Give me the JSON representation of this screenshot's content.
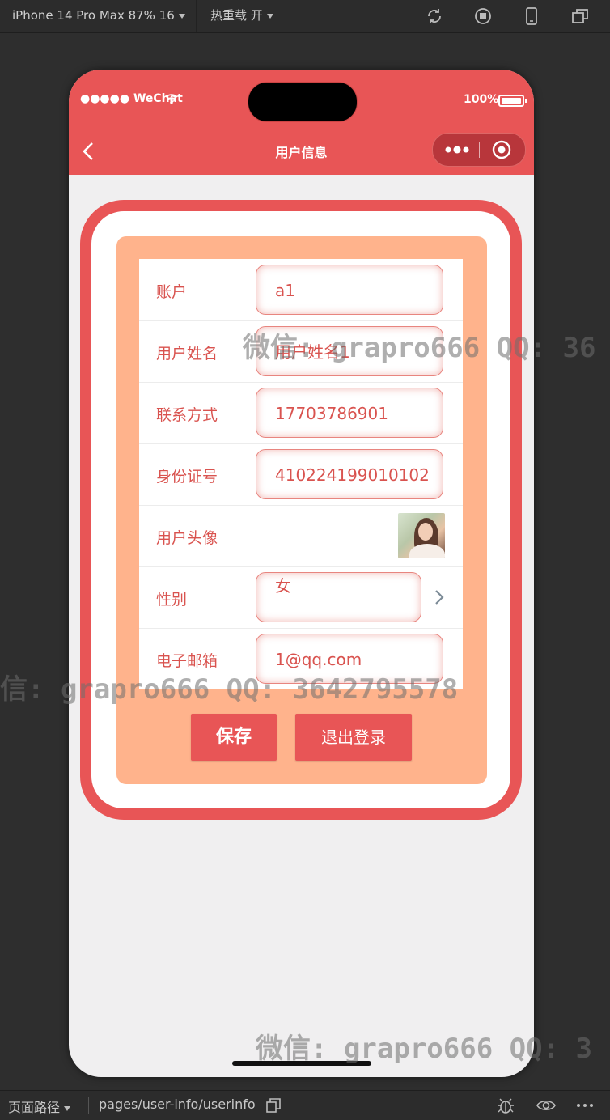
{
  "ide": {
    "device": "iPhone 14 Pro Max 87% 16",
    "hot_reload": "热重载 开",
    "path_label": "页面路径",
    "path": "pages/user-info/userinfo"
  },
  "status_bar": {
    "carrier": "●●●●● WeChat",
    "battery": "100%"
  },
  "nav": {
    "title": "用户信息"
  },
  "form": {
    "account": {
      "label": "账户",
      "value": "a1"
    },
    "name": {
      "label": "用户姓名",
      "value": "用户姓名1"
    },
    "phone": {
      "label": "联系方式",
      "value": "17703786901"
    },
    "id_card": {
      "label": "身份证号",
      "value": "410224199010102"
    },
    "avatar": {
      "label": "用户头像"
    },
    "gender": {
      "label": "性别",
      "value": "女"
    },
    "email": {
      "label": "电子邮箱",
      "value": "1@qq.com"
    }
  },
  "buttons": {
    "save": "保存",
    "logout": "退出登录"
  },
  "watermark": {
    "text_1": "微信: grapro666 QQ: 36",
    "text_2": "信: grapro666 QQ: 3642795578",
    "text_3": "微信: grapro666 QQ: 3"
  },
  "colors": {
    "primary": "#e85556",
    "panel": "#ffb38c",
    "label": "#d9534f"
  }
}
